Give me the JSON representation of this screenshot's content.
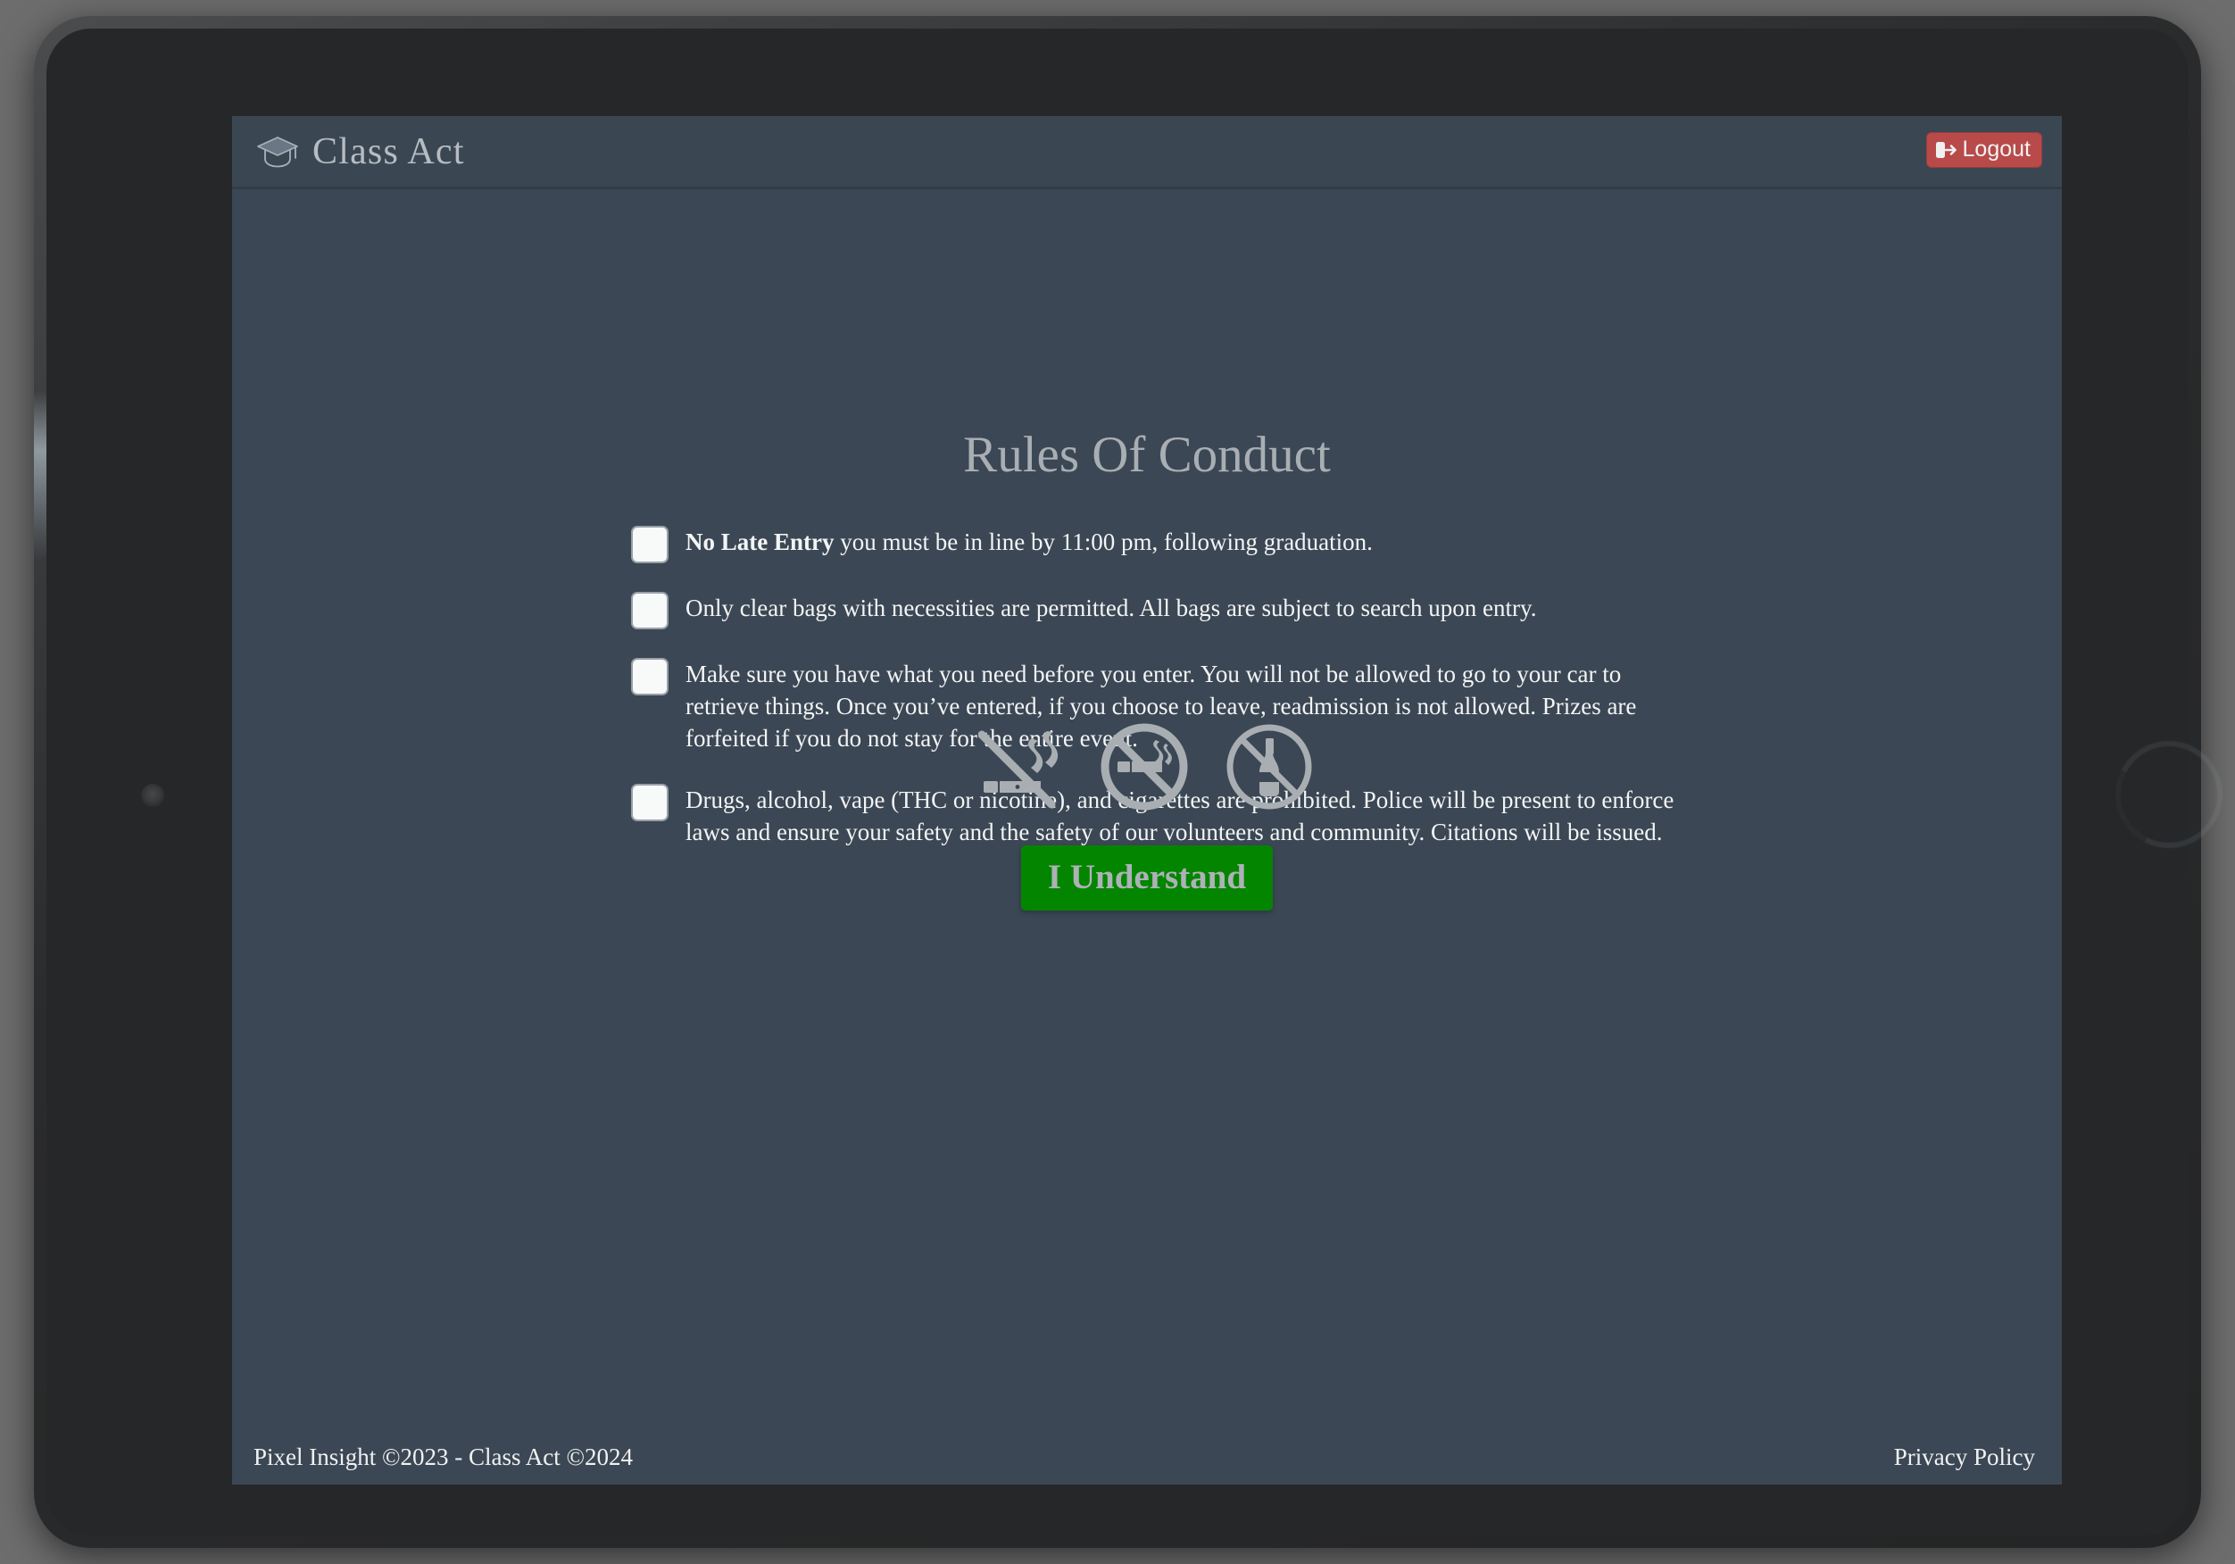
{
  "header": {
    "brand_title": "Class Act",
    "brand_icon": "graduation-cap-icon",
    "logout_label": "Logout",
    "logout_icon": "sign-out-icon",
    "logout_color": "#b84a4a"
  },
  "main": {
    "page_title": "Rules Of Conduct",
    "rules": [
      {
        "lead": "No Late Entry",
        "text": " you must be in line by 11:00 pm, following graduation.",
        "checked": false
      },
      {
        "lead": "",
        "text": "Only clear bags with necessities are permitted. All bags are subject to search upon entry.",
        "checked": false
      },
      {
        "lead": "",
        "text": "Make sure you have what you need before you enter. You will not be allowed to go to your car to retrieve things. Once you’ve entered, if you choose to leave, readmission is not allowed. Prizes are forfeited if you do not stay for the entire event.",
        "checked": false
      },
      {
        "lead": "",
        "text": "Drugs, alcohol, vape (THC or nicotine), and cigarettes are prohibited. Police will be present to enforce laws and ensure your safety and the safety of our volunteers and community. Citations will be issued.",
        "checked": false
      }
    ],
    "prohibition_icons": [
      "no-vaping-icon",
      "no-smoking-icon",
      "no-alcohol-icon"
    ],
    "confirm_label": "I Understand",
    "confirm_color": "#048500"
  },
  "footer": {
    "copyright": "Pixel Insight ©2023 - Class Act ©2024",
    "privacy_label": "Privacy Policy"
  },
  "theme": {
    "screen_background": "#3b4754",
    "header_background": "#3a4753",
    "title_color": "#a8aeb3",
    "text_color": "#f3f4f5"
  }
}
